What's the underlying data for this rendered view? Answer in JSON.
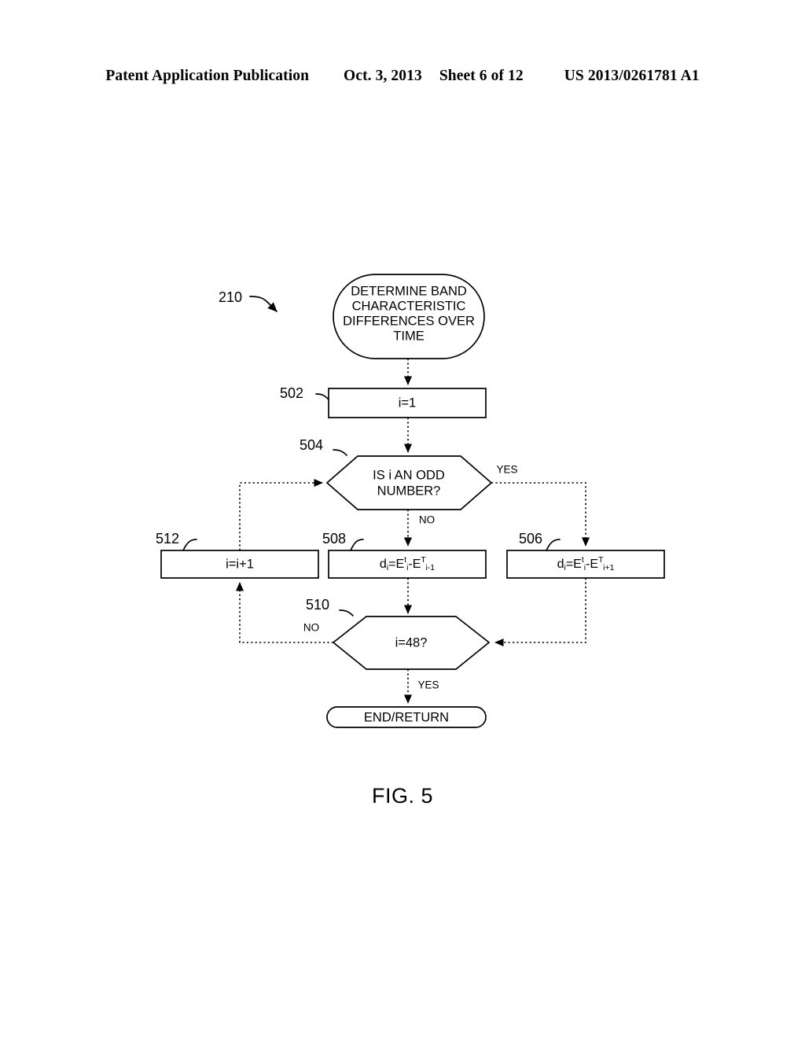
{
  "header": {
    "publication": "Patent Application Publication",
    "date": "Oct. 3, 2013",
    "sheet": "Sheet 6 of 12",
    "patent_number": "US 2013/0261781 A1"
  },
  "figure": {
    "caption": "FIG. 5",
    "diagram_ref": "210",
    "nodes": {
      "start": {
        "ref": "210",
        "type": "terminator-oval",
        "line1": "DETERMINE BAND",
        "line2": "CHARACTERISTIC",
        "line3": "DIFFERENCES OVER",
        "line4": "TIME"
      },
      "init": {
        "ref": "502",
        "type": "process",
        "text": "i=1"
      },
      "decision_odd": {
        "ref": "504",
        "type": "decision-hexagon",
        "line1": "IS i AN ODD",
        "line2": "NUMBER?",
        "branch_yes": "YES",
        "branch_no": "NO"
      },
      "calc_odd": {
        "ref": "506",
        "type": "process",
        "formula": "d_i=E^t_i-E^T_{i+1}",
        "f_d": "d",
        "f_d_sub": "i",
        "f_eq": "=E",
        "f_e1_sup": "t",
        "f_e1_sub": "i",
        "f_minus": "-E",
        "f_e2_sup": "T",
        "f_e2_sub": "i+1"
      },
      "calc_even": {
        "ref": "508",
        "type": "process",
        "formula": "d_i=E^t_i-E^T_{i-1}",
        "f_d": "d",
        "f_d_sub": "i",
        "f_eq": "=E",
        "f_e1_sup": "t",
        "f_e1_sub": "i",
        "f_minus": "-E",
        "f_e2_sup": "T",
        "f_e2_sub": "i-1"
      },
      "decision_done": {
        "ref": "510",
        "type": "decision-hexagon",
        "text": "i=48?",
        "branch_yes": "YES",
        "branch_no": "NO"
      },
      "increment": {
        "ref": "512",
        "type": "process",
        "text": "i=i+1"
      },
      "end": {
        "type": "terminator-stadium",
        "text": "END/RETURN"
      }
    }
  }
}
